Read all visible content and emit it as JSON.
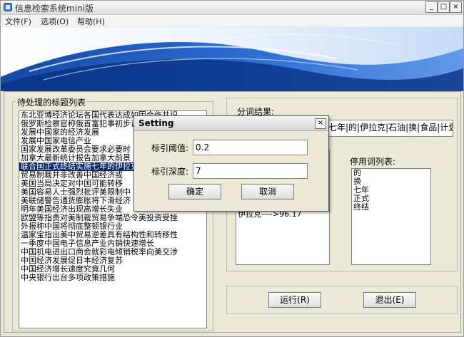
{
  "window": {
    "title": "信息检索系统mini版",
    "min_glyph": "_",
    "max_glyph": "□",
    "close_glyph": "×"
  },
  "menu": [
    {
      "label": "文件(F)"
    },
    {
      "label": "选项(O)"
    },
    {
      "label": "帮助(H)"
    }
  ],
  "left_group": {
    "label": "待处理的标题列表",
    "items": [
      "东北亚博经济论坛各国代表达成如因合作共识",
      "俄罗斯检察官称俄首富犯事初步调查中",
      "发展中国家的经济发展",
      "发展中国家电信产业",
      "国家发展改革委员会要求必要时",
      "加拿大最新统计报告加拿大前景",
      "联合国正式终结实施七年的伊拉克",
      "贸易制裁并非改善中国经济或",
      "美国当局决定对中国可能转移",
      "美国容易人士强烈批评美限制中",
      "美联储警告通货膨胀将下滑经济",
      "明年美国经济出现高增长失业",
      "欧盟等指责对美制裁贸易争端恐令美投资受挫",
      "外报称中国将彻底整顿银行业",
      "温家宝指出美中贸易逆差具有结构性和转移性",
      "一季度中国电子信息产业内销快速增长",
      "中国机电进出口商会就彩电倾销税率向美交涉",
      "中国经济发展促日本经济复苏",
      "中国经济增长速度究竟几何",
      "中央银行出台多项政策措施"
    ],
    "selected_index": 6
  },
  "right_group": {
    "result_label": "分词结果:",
    "result_text": "七年|的|伊拉克|石油|换|食品|计划",
    "stopwords_label": "停用词列表:",
    "stopwords": [
      "的",
      "换",
      "七年",
      "正式",
      "终结"
    ],
    "hidden_list_text": "伊拉克---->96.17"
  },
  "buttons": {
    "run": "运行(R)",
    "exit": "退出(E)"
  },
  "dialog": {
    "title": "Setting",
    "close_glyph": "×",
    "threshold_label": "标引阈值:",
    "threshold_value": "0.2",
    "depth_label": "标引深度:",
    "depth_value": "7",
    "ok_label": "确定",
    "cancel_label": "取消"
  },
  "colors": {
    "selection": "#0a246a",
    "banner_blue": "#1450b8"
  }
}
